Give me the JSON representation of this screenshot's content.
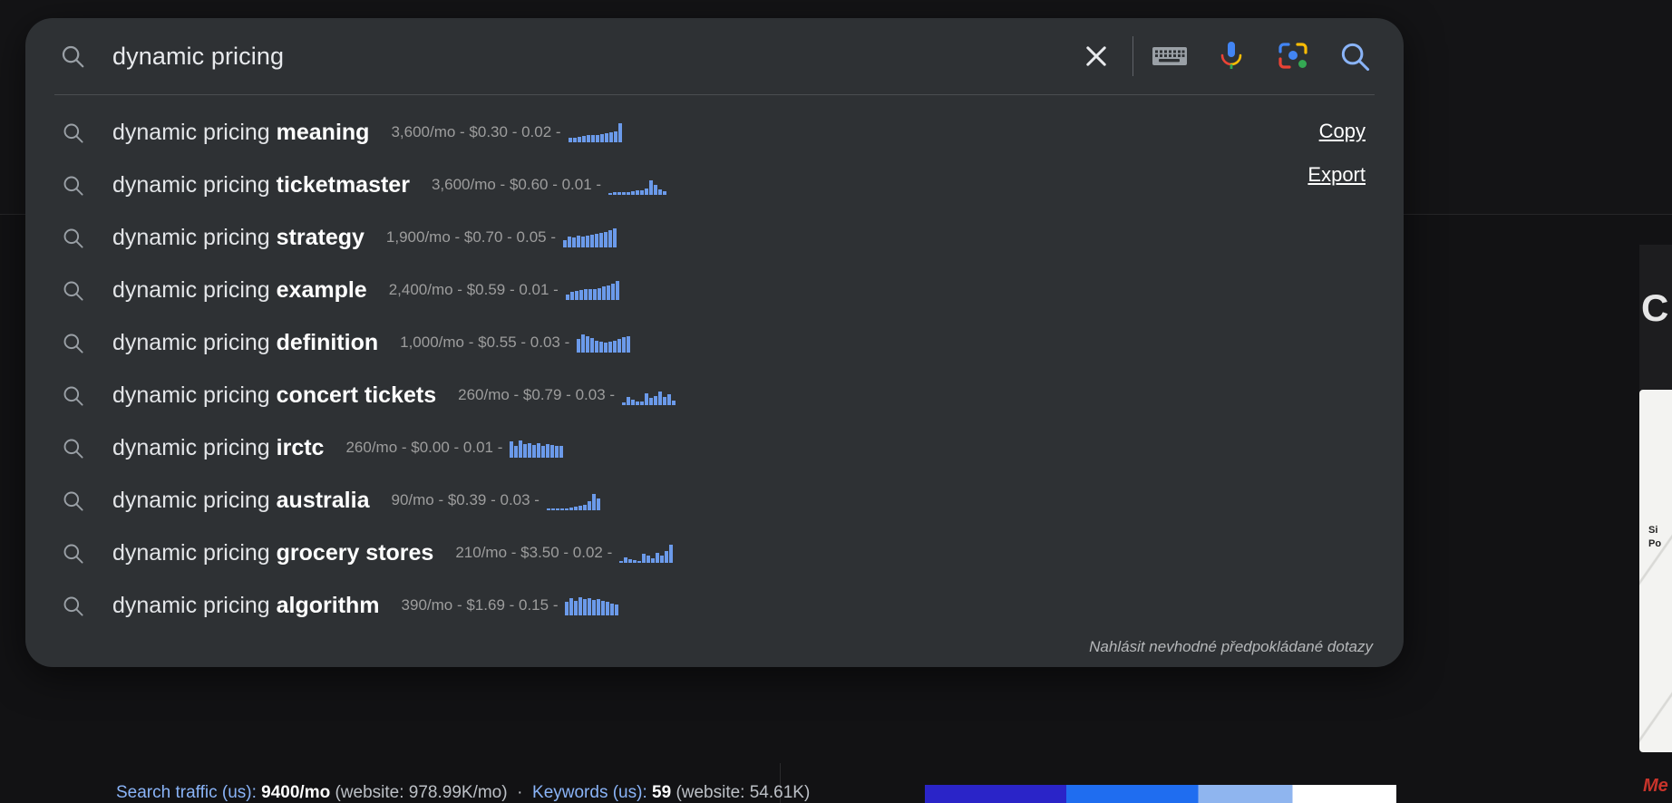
{
  "search": {
    "query": "dynamic pricing",
    "lead_icon": "search-icon",
    "actions": [
      {
        "name": "clear-icon",
        "label": "Clear"
      },
      {
        "name": "keyboard-icon",
        "label": "Keyboard"
      },
      {
        "name": "microphone-icon",
        "label": "Voice search"
      },
      {
        "name": "lens-camera-icon",
        "label": "Search by image"
      },
      {
        "name": "search-submit-icon",
        "label": "Search"
      }
    ]
  },
  "suggestions": [
    {
      "prefix": "dynamic pricing ",
      "bold": "meaning",
      "metrics": "3,600/mo - $0.30 - 0.02 -",
      "volume": "3,600/mo",
      "cpc": "$0.30",
      "competition": "0.02",
      "spark": [
        22,
        26,
        30,
        34,
        36,
        38,
        40,
        44,
        46,
        50,
        58,
        100
      ]
    },
    {
      "prefix": "dynamic pricing ",
      "bold": "ticketmaster",
      "metrics": "3,600/mo - $0.60 - 0.01 -",
      "volume": "3,600/mo",
      "cpc": "$0.60",
      "competition": "0.01",
      "spark": [
        10,
        12,
        12,
        14,
        16,
        18,
        22,
        26,
        34,
        74,
        54,
        30,
        20
      ]
    },
    {
      "prefix": "dynamic pricing ",
      "bold": "strategy",
      "metrics": "1,900/mo - $0.70 - 0.05 -",
      "volume": "1,900/mo",
      "cpc": "$0.70",
      "competition": "0.05",
      "spark": [
        38,
        56,
        50,
        62,
        58,
        64,
        66,
        70,
        74,
        80,
        92,
        100
      ]
    },
    {
      "prefix": "dynamic pricing ",
      "bold": "example",
      "metrics": "2,400/mo - $0.59 - 0.01 -",
      "volume": "2,400/mo",
      "cpc": "$0.59",
      "competition": "0.01",
      "spark": [
        30,
        42,
        48,
        52,
        56,
        58,
        56,
        62,
        70,
        76,
        86,
        100
      ]
    },
    {
      "prefix": "dynamic pricing ",
      "bold": "definition",
      "metrics": "1,000/mo - $0.55 - 0.03 -",
      "volume": "1,000/mo",
      "cpc": "$0.55",
      "competition": "0.03",
      "spark": [
        70,
        96,
        86,
        78,
        62,
        56,
        52,
        58,
        64,
        70,
        80,
        88
      ]
    },
    {
      "prefix": "dynamic pricing ",
      "bold": "concert tickets",
      "metrics": "260/mo - $0.79 - 0.03 -",
      "volume": "260/mo",
      "cpc": "$0.79",
      "competition": "0.03",
      "spark": [
        14,
        44,
        30,
        20,
        18,
        62,
        36,
        48,
        70,
        42,
        58,
        24
      ]
    },
    {
      "prefix": "dynamic pricing ",
      "bold": "irctc",
      "metrics": "260/mo - $0.00 - 0.01 -",
      "volume": "260/mo",
      "cpc": "$0.00",
      "competition": "0.01",
      "spark": [
        84,
        60,
        92,
        70,
        78,
        66,
        74,
        62,
        70,
        66,
        60,
        64
      ]
    },
    {
      "prefix": "dynamic pricing ",
      "bold": "australia",
      "metrics": "90/mo - $0.39 - 0.03 -",
      "volume": "90/mo",
      "cpc": "$0.39",
      "competition": "0.03",
      "spark": [
        6,
        6,
        8,
        8,
        10,
        14,
        18,
        22,
        30,
        46,
        84,
        62
      ]
    },
    {
      "prefix": "dynamic pricing ",
      "bold": "grocery stores",
      "metrics": "210/mo - $3.50 - 0.02 -",
      "volume": "210/mo",
      "cpc": "$3.50",
      "competition": "0.02",
      "spark": [
        8,
        30,
        18,
        12,
        10,
        46,
        36,
        24,
        54,
        40,
        62,
        96
      ]
    },
    {
      "prefix": "dynamic pricing ",
      "bold": "algorithm",
      "metrics": "390/mo - $1.69 - 0.15 -",
      "volume": "390/mo",
      "cpc": "$1.69",
      "competition": "0.15",
      "spark": [
        72,
        92,
        78,
        96,
        84,
        90,
        80,
        86,
        74,
        70,
        62,
        58
      ]
    }
  ],
  "side_tools": {
    "copy_label": "Copy",
    "export_label": "Export"
  },
  "footer": {
    "report_label": "Nahlásit nevhodné předpokládané dotazy"
  },
  "background": {
    "stats_lead": "Search traffic (us):",
    "stats_value_1": "9400/mo",
    "stats_paren_1": "(website: 978.99K/mo)",
    "stats_lead_2": "Keywords (us):",
    "stats_value_2": "59",
    "stats_paren_2": "(website: 54.61K)",
    "card_line_1": "Si",
    "card_line_2": "Po",
    "head_glyph": "C",
    "me_text": "Me"
  },
  "colors": {
    "overlay_bg": "#2e3134",
    "page_bg": "#141416",
    "spark_blue": "#6b9aea",
    "text_primary": "#e8eaed",
    "text_muted": "#9d9d9d",
    "link_blue": "#8ab4f8"
  }
}
